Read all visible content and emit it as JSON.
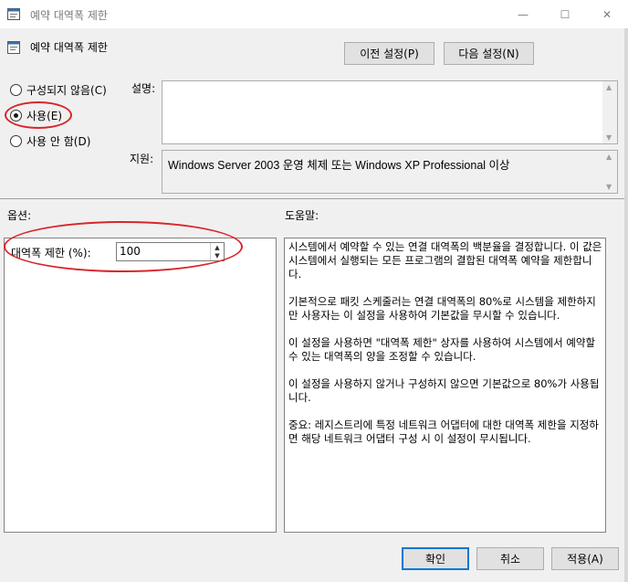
{
  "window": {
    "title": "예약 대역폭 제한",
    "controls": {
      "minimize": "—",
      "maximize": "☐",
      "close": "✕"
    }
  },
  "header": {
    "title": "예약 대역폭 제한",
    "prev_setting": "이전 설정(P)",
    "next_setting": "다음 설정(N)"
  },
  "state": {
    "options": [
      {
        "label": "구성되지 않음(C)",
        "checked": false
      },
      {
        "label": "사용(E)",
        "checked": true
      },
      {
        "label": "사용 안 함(D)",
        "checked": false
      }
    ]
  },
  "description": {
    "label": "설명:",
    "value": ""
  },
  "supported": {
    "label": "지원:",
    "value": "Windows Server 2003 운영 체제 또는 Windows XP Professional 이상"
  },
  "options_section": {
    "label": "옵션:",
    "bandwidth_label": "대역폭 제한 (%):",
    "bandwidth_value": "100"
  },
  "help_section": {
    "label": "도움말:",
    "paragraphs": [
      "시스템에서 예약할 수 있는 연결 대역폭의 백분율을 결정합니다. 이 값은 시스템에서 실행되는 모든 프로그램의 결합된 대역폭 예약을 제한합니다.",
      "기본적으로 패킷 스케줄러는 연결 대역폭의 80%로 시스템을 제한하지만 사용자는 이 설정을 사용하여 기본값을 무시할 수 있습니다.",
      "이 설정을 사용하면 \"대역폭 제한\" 상자를 사용하여 시스템에서 예약할 수 있는 대역폭의 양을 조정할 수 있습니다.",
      "이 설정을 사용하지 않거나 구성하지 않으면 기본값으로 80%가 사용됩니다.",
      "중요: 레지스트리에 특정 네트워크 어댑터에 대한 대역폭 제한을 지정하면 해당 네트워크 어댑터 구성 시 이 설정이 무시됩니다."
    ]
  },
  "footer": {
    "ok": "확인",
    "cancel": "취소",
    "apply": "적용(A)"
  },
  "colors": {
    "annotation": "#d9262b",
    "focus": "#0078d7"
  },
  "icons": {
    "title": "policy-setting-icon",
    "header": "policy-setting-icon"
  }
}
